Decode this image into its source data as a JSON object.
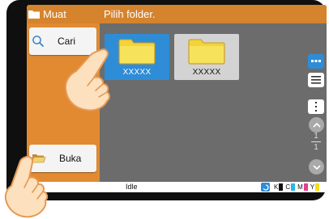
{
  "app": {
    "title": "Muat"
  },
  "header": {
    "title": "Pilih folder."
  },
  "sidebar": {
    "search_label": "Cari",
    "open_label": "Buka"
  },
  "folders": [
    {
      "name": "XXXXX",
      "selected": true
    },
    {
      "name": "XXXXX",
      "selected": false
    }
  ],
  "pager": {
    "current": "1",
    "total": "1"
  },
  "status": {
    "left_text": "th",
    "text": "Idle"
  },
  "toner": [
    {
      "label": "K",
      "color": "#111111"
    },
    {
      "label": "C",
      "color": "#29b6e8"
    },
    {
      "label": "M",
      "color": "#e83e8c"
    },
    {
      "label": "Y",
      "color": "#f2de1d"
    }
  ],
  "colors": {
    "accent": "#e18a32",
    "titlebar": "#d5832c",
    "selection": "#2f8cd6",
    "panel": "#6c6c6c"
  }
}
